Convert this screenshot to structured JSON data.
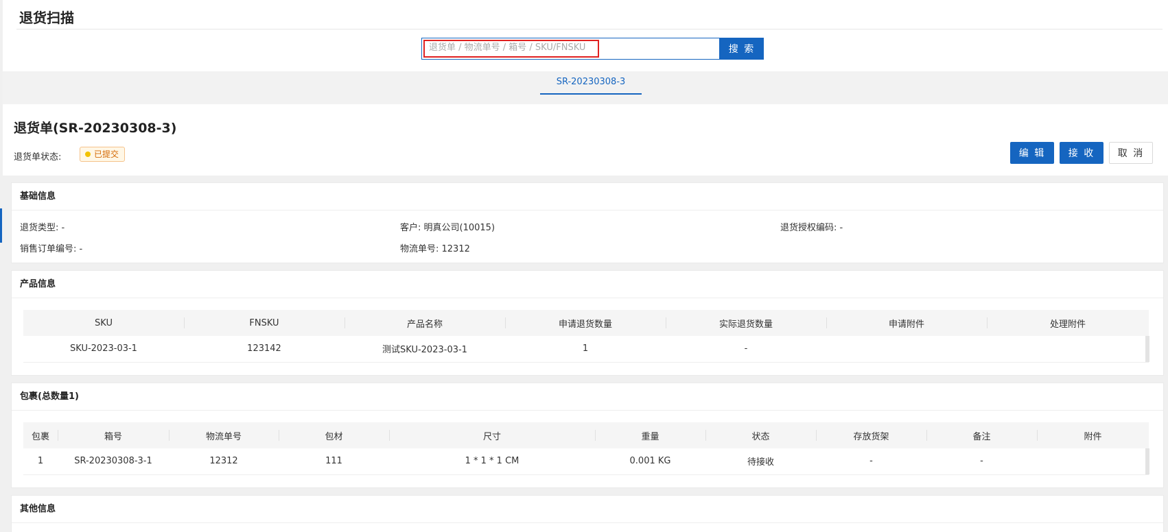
{
  "page": {
    "title": "退货扫描"
  },
  "search": {
    "placeholder": "退货单 / 物流单号 / 箱号 / SKU/FNSKU",
    "value": "",
    "button_label": "搜 索"
  },
  "tabs": [
    {
      "label": "SR-20230308-3",
      "active": true
    }
  ],
  "document": {
    "title": "退货单(SR-20230308-3)",
    "status_label": "退货单状态:",
    "status_value": "已提交",
    "buttons": {
      "edit": "编 辑",
      "receive": "接 收",
      "cancel": "取 消"
    }
  },
  "basic_info": {
    "heading": "基础信息",
    "return_type": "退货类型: -",
    "customer": "客户: 明真公司(10015)",
    "rma_code": "退货授权编码: -",
    "sales_order": "销售订单编号: -",
    "tracking_no": "物流单号: 12312"
  },
  "product_info": {
    "heading": "产品信息",
    "columns": [
      "SKU",
      "FNSKU",
      "产品名称",
      "申请退货数量",
      "实际退货数量",
      "申请附件",
      "处理附件"
    ],
    "rows": [
      [
        "SKU-2023-03-1",
        "123142",
        "测试SKU-2023-03-1",
        "1",
        "-",
        "",
        ""
      ]
    ]
  },
  "package_info": {
    "heading": "包裹(总数量1)",
    "columns": [
      "包裹",
      "箱号",
      "物流单号",
      "包材",
      "尺寸",
      "重量",
      "状态",
      "存放货架",
      "备注",
      "附件"
    ],
    "rows": [
      [
        "1",
        "SR-20230308-3-1",
        "12312",
        "111",
        "1 * 1 * 1 CM",
        "0.001 KG",
        "待接收",
        "-",
        "-",
        ""
      ]
    ]
  },
  "other_info": {
    "heading": "其他信息"
  },
  "colors": {
    "primary": "#1565c0",
    "highlight": "#e02020",
    "status_bg": "#fff7e6",
    "status_text": "#d46b08"
  }
}
